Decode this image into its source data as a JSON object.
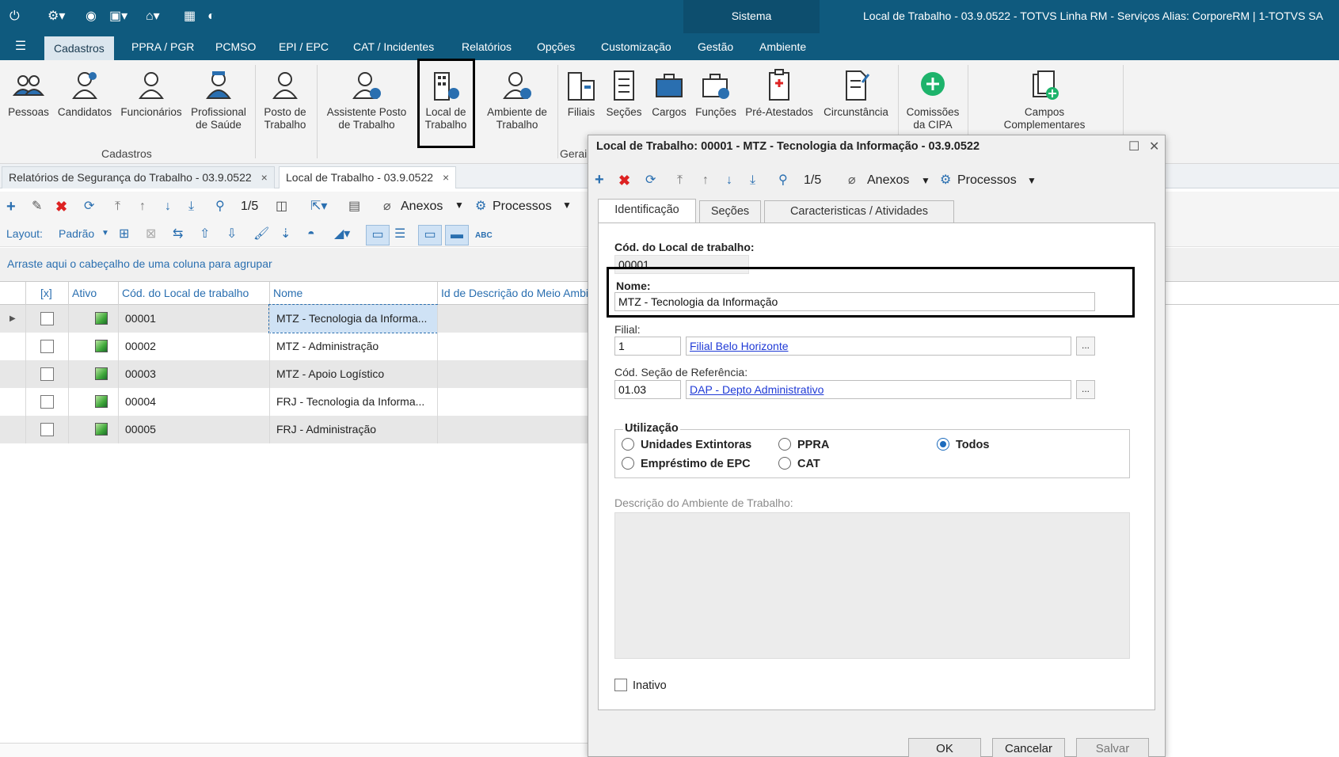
{
  "titlebar": {
    "sistema": "Sistema",
    "title": "Local de Trabalho - 03.9.0522 - TOTVS Linha RM - Serviços  Alias: CorporeRM | 1-TOTVS SA",
    "icons": [
      "power-icon",
      "tools-icon",
      "eye-icon",
      "window-icon",
      "home-icon",
      "grid-icon",
      "globe-icon"
    ]
  },
  "menu": {
    "tabs": [
      "Cadastros",
      "PPRA / PGR",
      "PCMSO",
      "EPI / EPC",
      "CAT / Incidentes",
      "Relatórios",
      "Opções",
      "Customização",
      "Gestão",
      "Ambiente"
    ]
  },
  "ribbon": {
    "buttons": [
      {
        "label": "Pessoas"
      },
      {
        "label": "Candidatos"
      },
      {
        "label": "Funcionários"
      },
      {
        "label": "Profissional de Saúde"
      },
      {
        "label": "Posto de Trabalho"
      },
      {
        "label": "Assistente Posto de Trabalho"
      },
      {
        "label": "Local de Trabalho"
      },
      {
        "label": "Ambiente de Trabalho"
      },
      {
        "label": "Filiais"
      },
      {
        "label": "Seções"
      },
      {
        "label": "Cargos"
      },
      {
        "label": "Funções"
      },
      {
        "label": "Pré-Atestados"
      },
      {
        "label": "Circunstância"
      },
      {
        "label": "Comissões da CIPA"
      },
      {
        "label": "Campos Complementares"
      }
    ],
    "group_cadastros": "Cadastros",
    "group_gerais": "Gerai"
  },
  "doctabs": [
    {
      "label": "Relatórios de Segurança do Trabalho - 03.9.0522"
    },
    {
      "label": "Local de Trabalho - 03.9.0522"
    }
  ],
  "grid_toolbar": {
    "pager": "1/5",
    "anexos": "Anexos",
    "processos": "Processos",
    "layout_label": "Layout:",
    "layout_value": "Padrão"
  },
  "group_hint": "Arraste aqui o cabeçalho de uma coluna para agrupar",
  "grid": {
    "columns": [
      "[x]",
      "Ativo",
      "Cód. do Local de trabalho",
      "Nome",
      "Id de Descrição do Meio Ambie"
    ],
    "rows": [
      {
        "code": "00001",
        "name": "MTZ - Tecnologia da Informa..."
      },
      {
        "code": "00002",
        "name": "MTZ - Administração"
      },
      {
        "code": "00003",
        "name": "MTZ - Apoio Logístico"
      },
      {
        "code": "00004",
        "name": "FRJ - Tecnologia da Informa..."
      },
      {
        "code": "00005",
        "name": "FRJ - Administração"
      }
    ]
  },
  "dialog": {
    "title": "Local de Trabalho: 00001 - MTZ - Tecnologia da Informação - 03.9.0522",
    "pager": "1/5",
    "anexos": "Anexos",
    "processos": "Processos",
    "tabs": [
      "Identificação",
      "Seções",
      "Caracteristicas / Atividades"
    ],
    "cod_label": "Cód. do Local de trabalho:",
    "cod_value": "00001",
    "nome_label": "Nome:",
    "nome_value": "MTZ - Tecnologia da Informação",
    "filial_label": "Filial:",
    "filial_code": "1",
    "filial_name": "Filial Belo Horizonte",
    "secao_label": "Cód. Seção de Referência:",
    "secao_code": "01.03",
    "secao_name": "DAP - Depto Administrativo",
    "ellipsis": "...",
    "utilizacao_label": "Utilização",
    "radios": [
      {
        "label": "Unidades Extintoras",
        "selected": false
      },
      {
        "label": "PPRA",
        "selected": false
      },
      {
        "label": "Todos",
        "selected": true
      },
      {
        "label": "Empréstimo de EPC",
        "selected": false
      },
      {
        "label": "CAT",
        "selected": false
      }
    ],
    "descricao_label": "Descrição do Ambiente de Trabalho:",
    "inativo_label": "Inativo",
    "buttons": {
      "ok": "OK",
      "cancel": "Cancelar",
      "save": "Salvar"
    }
  },
  "colors": {
    "titlebar": "#0f5a7e",
    "accent": "#2a6fb0",
    "link": "#1f3ad6",
    "delete": "#dd2222"
  }
}
